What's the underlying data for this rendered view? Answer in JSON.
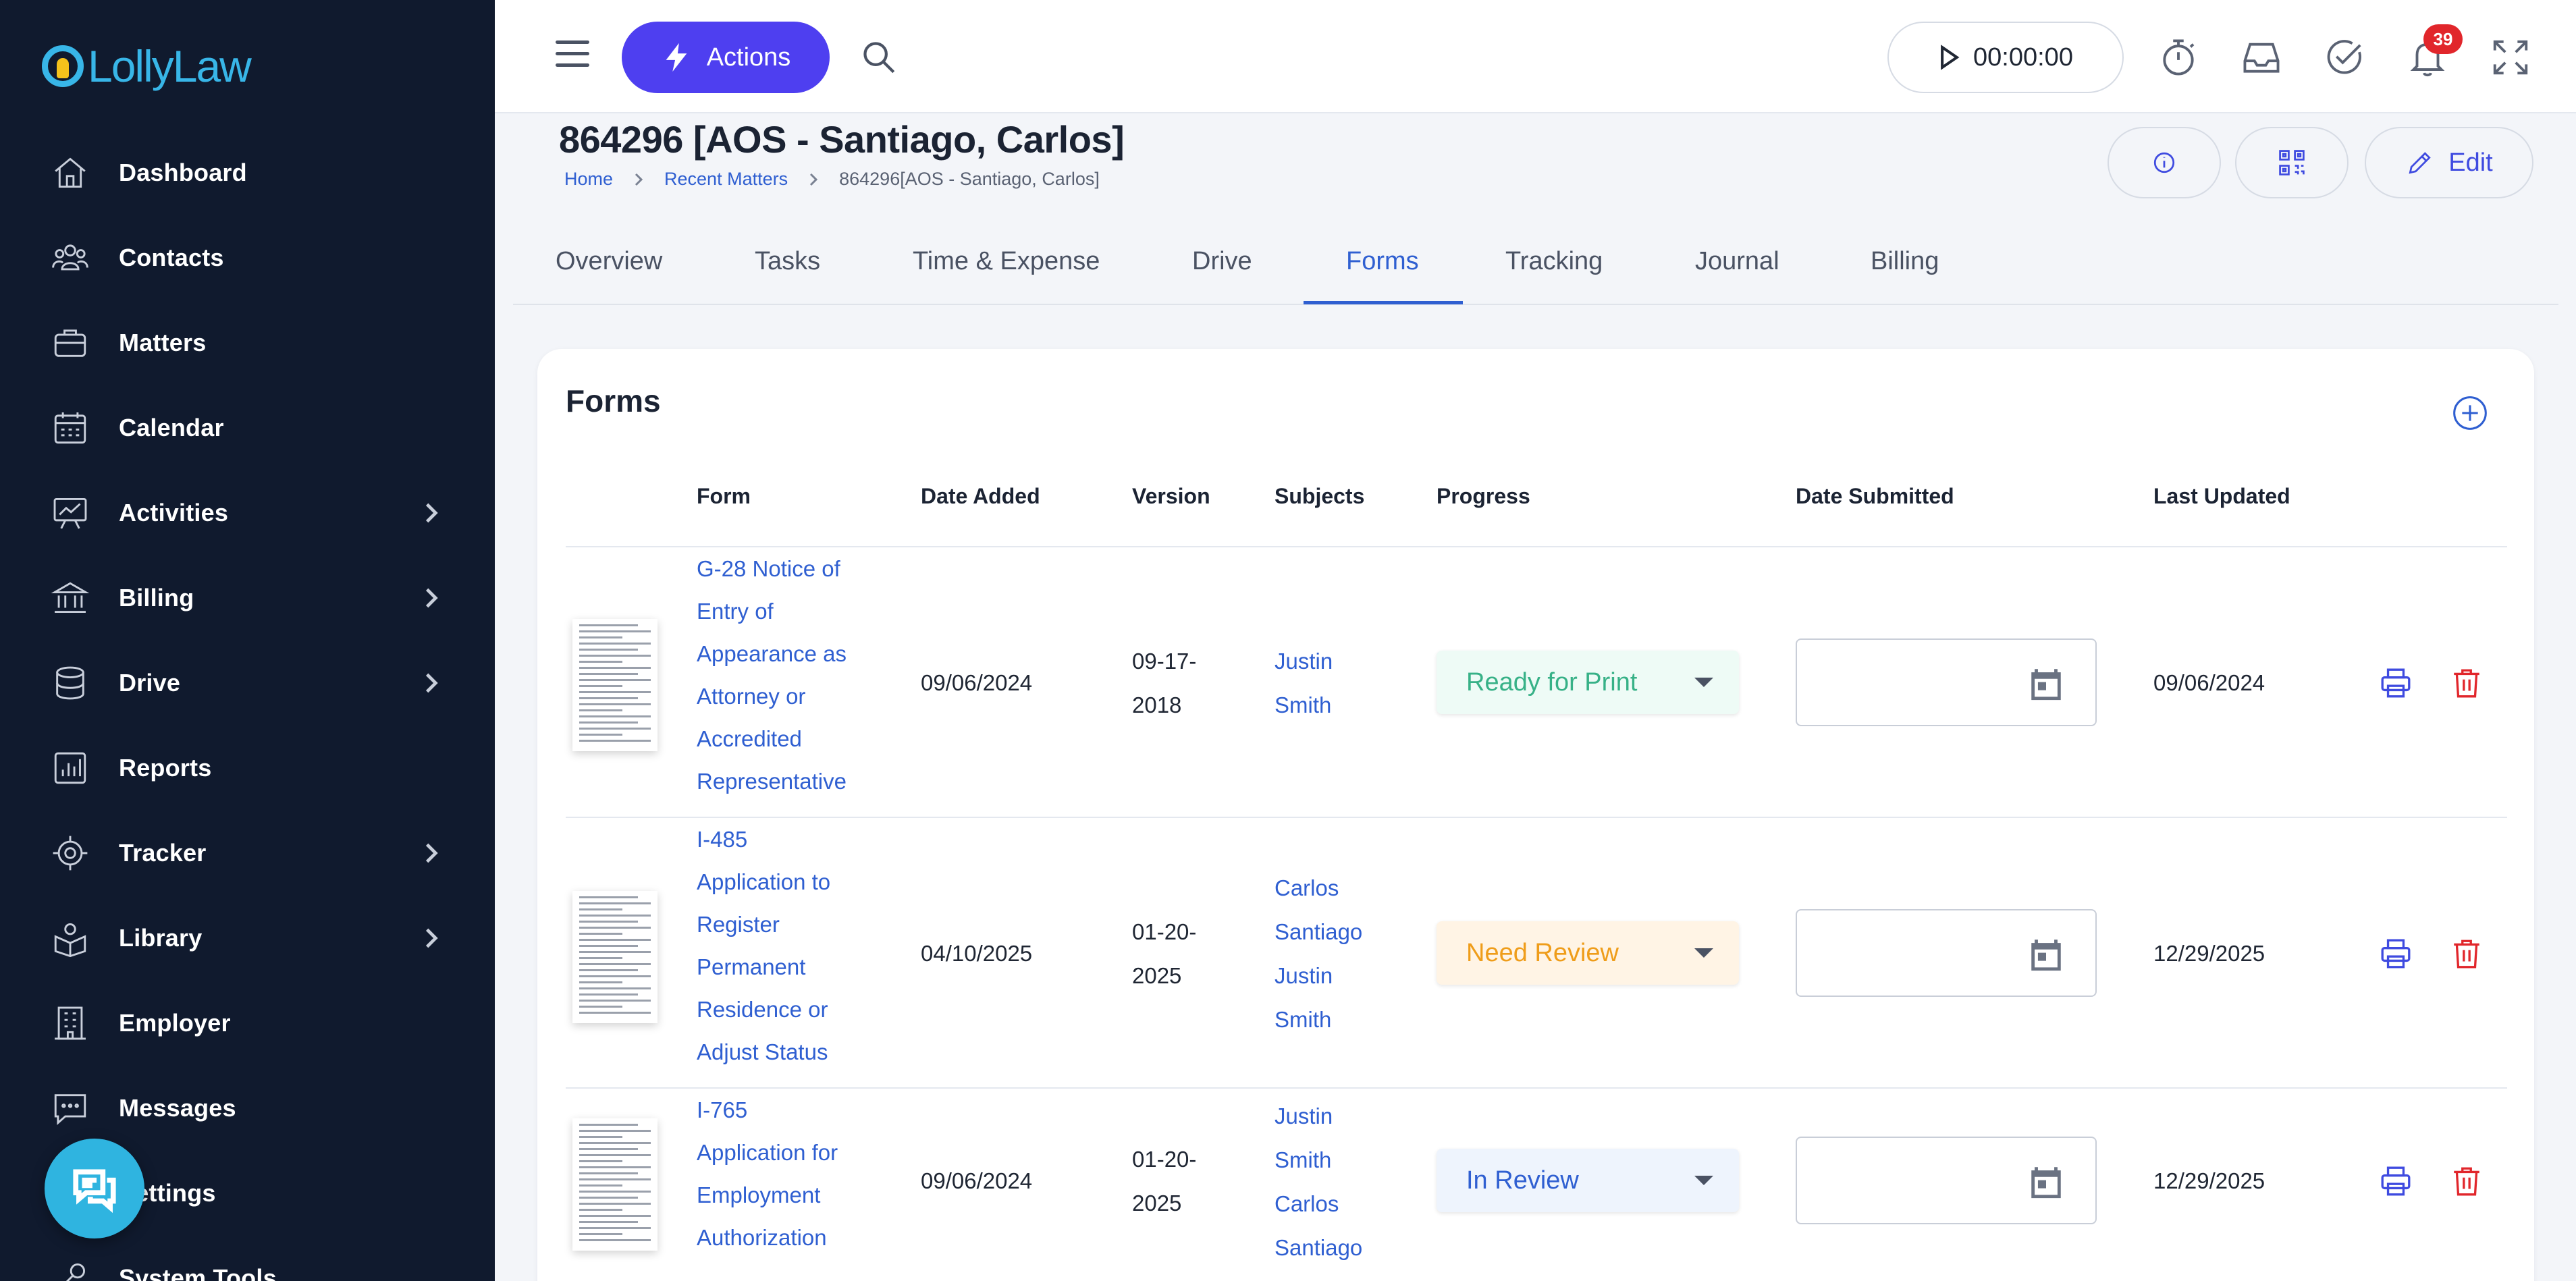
{
  "app": {
    "logo_text": "LollyLaw"
  },
  "sidebar": {
    "items": [
      {
        "label": "Dashboard",
        "icon": "home-icon",
        "has_children": false
      },
      {
        "label": "Contacts",
        "icon": "contacts-icon",
        "has_children": false
      },
      {
        "label": "Matters",
        "icon": "briefcase-icon",
        "has_children": false
      },
      {
        "label": "Calendar",
        "icon": "calendar-icon",
        "has_children": false
      },
      {
        "label": "Activities",
        "icon": "activities-icon",
        "has_children": true
      },
      {
        "label": "Billing",
        "icon": "bank-icon",
        "has_children": true
      },
      {
        "label": "Drive",
        "icon": "database-icon",
        "has_children": true
      },
      {
        "label": "Reports",
        "icon": "reports-icon",
        "has_children": false
      },
      {
        "label": "Tracker",
        "icon": "target-icon",
        "has_children": true
      },
      {
        "label": "Library",
        "icon": "library-icon",
        "has_children": true
      },
      {
        "label": "Employer",
        "icon": "building-icon",
        "has_children": false
      },
      {
        "label": "Messages",
        "icon": "message-icon",
        "has_children": false
      },
      {
        "label": "Settings",
        "icon": "gear-icon",
        "has_children": false
      },
      {
        "label": "System Tools",
        "icon": "tools-icon",
        "has_children": false
      }
    ]
  },
  "topbar": {
    "actions_label": "Actions",
    "timer_value": "00:00:00",
    "notification_count": "39"
  },
  "header": {
    "title": "864296 [AOS - Santiago, Carlos]",
    "breadcrumb": [
      "Home",
      "Recent Matters",
      "864296[AOS - Santiago, Carlos]"
    ],
    "edit_label": "Edit"
  },
  "tabs": [
    {
      "label": "Overview",
      "active": false
    },
    {
      "label": "Tasks",
      "active": false
    },
    {
      "label": "Time & Expense",
      "active": false
    },
    {
      "label": "Drive",
      "active": false
    },
    {
      "label": "Forms",
      "active": true
    },
    {
      "label": "Tracking",
      "active": false
    },
    {
      "label": "Journal",
      "active": false
    },
    {
      "label": "Billing",
      "active": false
    }
  ],
  "forms": {
    "title": "Forms",
    "columns": [
      "Form",
      "Date Added",
      "Version",
      "Subjects",
      "Progress",
      "Date Submitted",
      "Last Updated"
    ],
    "rows": [
      {
        "form_lines": [
          "G-28 Notice of",
          "Entry of",
          "Appearance as",
          "Attorney or",
          "Accredited",
          "Representative"
        ],
        "date_added": "09/06/2024",
        "version_lines": [
          "09-17-",
          "2018"
        ],
        "subject_lines": [
          "Justin",
          "Smith"
        ],
        "progress": "Ready for Print",
        "progress_color": "#37b187",
        "date_submitted": "",
        "last_updated": "09/06/2024"
      },
      {
        "form_lines": [
          "I-485",
          "Application to",
          "Register",
          "Permanent",
          "Residence or",
          "Adjust Status"
        ],
        "date_added": "04/10/2025",
        "version_lines": [
          "01-20-",
          "2025"
        ],
        "subject_lines": [
          "Carlos",
          "Santiago",
          "Justin",
          "Smith"
        ],
        "progress": "Need Review",
        "progress_color": "#ef9d1a",
        "date_submitted": "",
        "last_updated": "12/29/2025"
      },
      {
        "form_lines": [
          "I-765",
          "Application for",
          "Employment",
          "Authorization"
        ],
        "date_added": "09/06/2024",
        "version_lines": [
          "01-20-",
          "2025"
        ],
        "subject_lines": [
          "Justin",
          "Smith",
          "Carlos",
          "Santiago"
        ],
        "progress": "In Review",
        "progress_color": "#2f5fd1",
        "date_submitted": "",
        "last_updated": "12/29/2025"
      }
    ]
  },
  "colors": {
    "sidebar_bg": "#101a2e",
    "accent": "#4e3ff0",
    "link": "#2f5fd1",
    "danger": "#e1262b"
  }
}
